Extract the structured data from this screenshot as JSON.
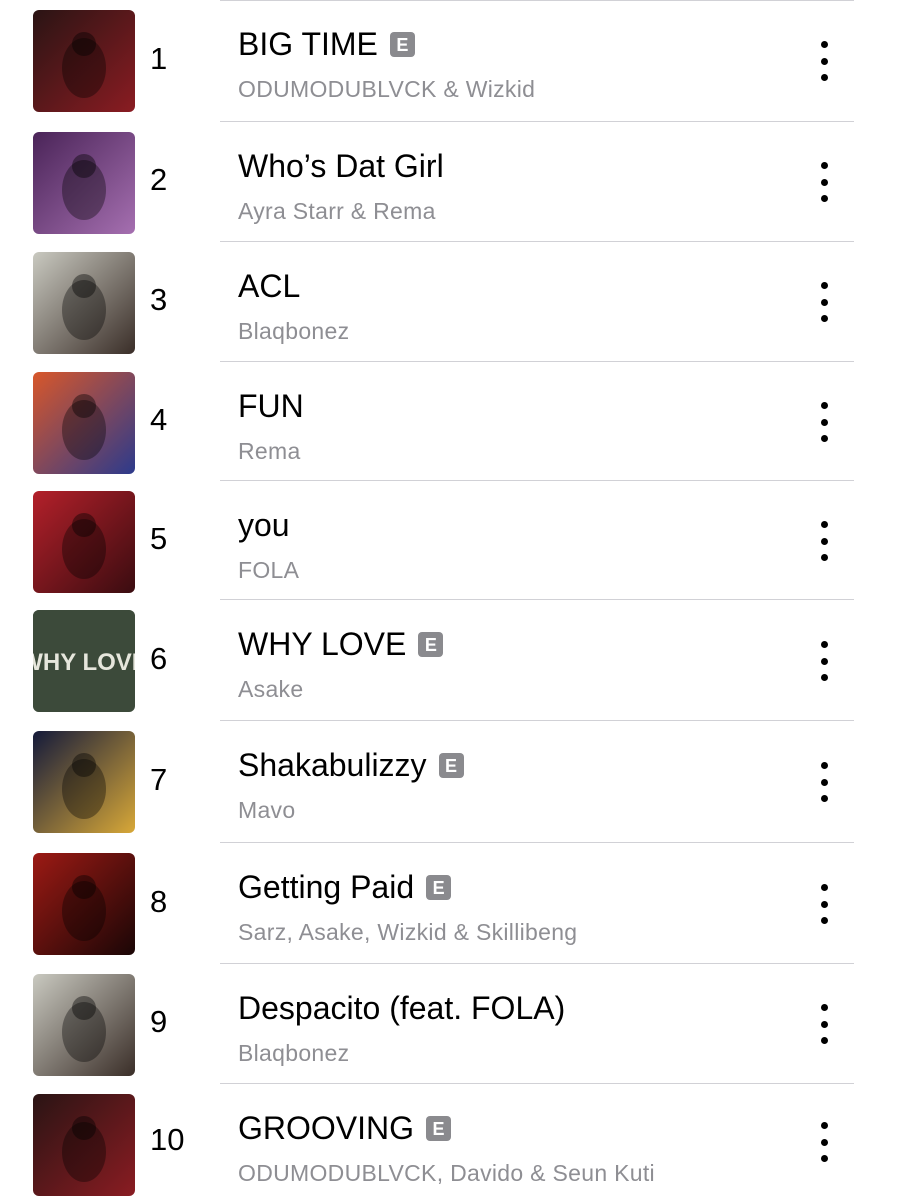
{
  "list": {
    "explicit_badge": "E",
    "more_icon": "ellipsis-vertical-icon",
    "songs": [
      {
        "rank": "1",
        "title": "BIG TIME",
        "explicit": true,
        "artist": "ODUMODUBLVCK & Wizkid",
        "art_colors": [
          "#2a1414",
          "#8a1c22"
        ]
      },
      {
        "rank": "2",
        "title": "Who’s Dat Girl",
        "explicit": false,
        "artist": "Ayra Starr & Rema",
        "art_colors": [
          "#4a2458",
          "#a56fb0"
        ]
      },
      {
        "rank": "3",
        "title": "ACL",
        "explicit": false,
        "artist": "Blaqbonez",
        "art_colors": [
          "#c9c9c0",
          "#3a2e28"
        ]
      },
      {
        "rank": "4",
        "title": "FUN",
        "explicit": false,
        "artist": "Rema",
        "art_colors": [
          "#d8572a",
          "#2c3a8c"
        ]
      },
      {
        "rank": "5",
        "title": "you",
        "explicit": false,
        "artist": "FOLA",
        "art_colors": [
          "#b3202a",
          "#3a0c10"
        ]
      },
      {
        "rank": "6",
        "title": "WHY LOVE",
        "explicit": true,
        "artist": "Asake",
        "art_colors": [
          "#3c4a3a",
          "#e6e6dc"
        ],
        "art_text": "WHY LOVE"
      },
      {
        "rank": "7",
        "title": "Shakabulizzy",
        "explicit": true,
        "artist": "Mavo",
        "art_colors": [
          "#141a3a",
          "#d8a838"
        ]
      },
      {
        "rank": "8",
        "title": "Getting Paid",
        "explicit": true,
        "artist": "Sarz, Asake, Wizkid & Skillibeng",
        "art_colors": [
          "#9c1a14",
          "#1a0606"
        ]
      },
      {
        "rank": "9",
        "title": "Despacito (feat. FOLA)",
        "explicit": false,
        "artist": "Blaqbonez",
        "art_colors": [
          "#c9c9c0",
          "#3a2e28"
        ]
      },
      {
        "rank": "10",
        "title": "GROOVING",
        "explicit": true,
        "artist": "ODUMODUBLVCK, Davido & Seun Kuti",
        "art_colors": [
          "#2a1414",
          "#8a1c22"
        ]
      }
    ]
  }
}
